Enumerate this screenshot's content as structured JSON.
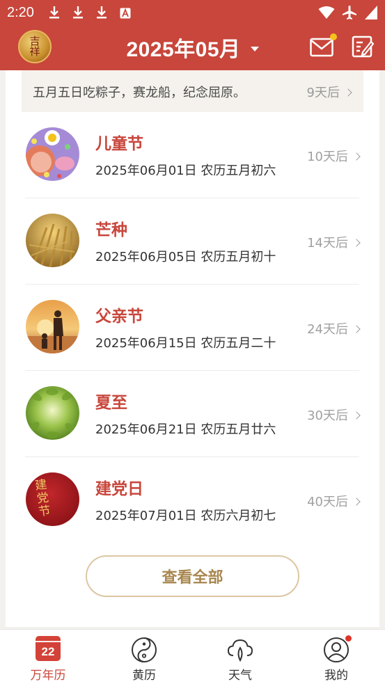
{
  "status_bar": {
    "time": "2:20"
  },
  "header": {
    "logo_text": "吉祥",
    "month_title": "2025年05月",
    "accent_color": "#c8463b"
  },
  "previous_item": {
    "description": "五月五日吃粽子，赛龙船，纪念屈原。",
    "countdown": "9天后"
  },
  "festivals": [
    {
      "name": "儿童节",
      "date": "2025年06月01日 农历五月初六",
      "countdown": "10天后",
      "thumb_icon": "childrens-day-image"
    },
    {
      "name": "芒种",
      "date": "2025年06月05日 农历五月初十",
      "countdown": "14天后",
      "thumb_icon": "wheat-field-image"
    },
    {
      "name": "父亲节",
      "date": "2025年06月15日 农历五月二十",
      "countdown": "24天后",
      "thumb_icon": "father-child-sunset-image"
    },
    {
      "name": "夏至",
      "date": "2025年06月21日 农历五月廿六",
      "countdown": "30天后",
      "thumb_icon": "green-leaves-image"
    },
    {
      "name": "建党日",
      "date": "2025年07月01日 农历六月初七",
      "countdown": "40天后",
      "thumb_icon": "party-day-image",
      "thumb_text": "建党节"
    }
  ],
  "view_all_label": "查看全部",
  "bottom_nav": [
    {
      "label": "万年历",
      "icon": "calendar-icon",
      "icon_text": "22",
      "active": true
    },
    {
      "label": "黄历",
      "icon": "yin-yang-icon",
      "active": false
    },
    {
      "label": "天气",
      "icon": "weather-cloud-icon",
      "active": false
    },
    {
      "label": "我的",
      "icon": "profile-icon",
      "active": false
    }
  ]
}
